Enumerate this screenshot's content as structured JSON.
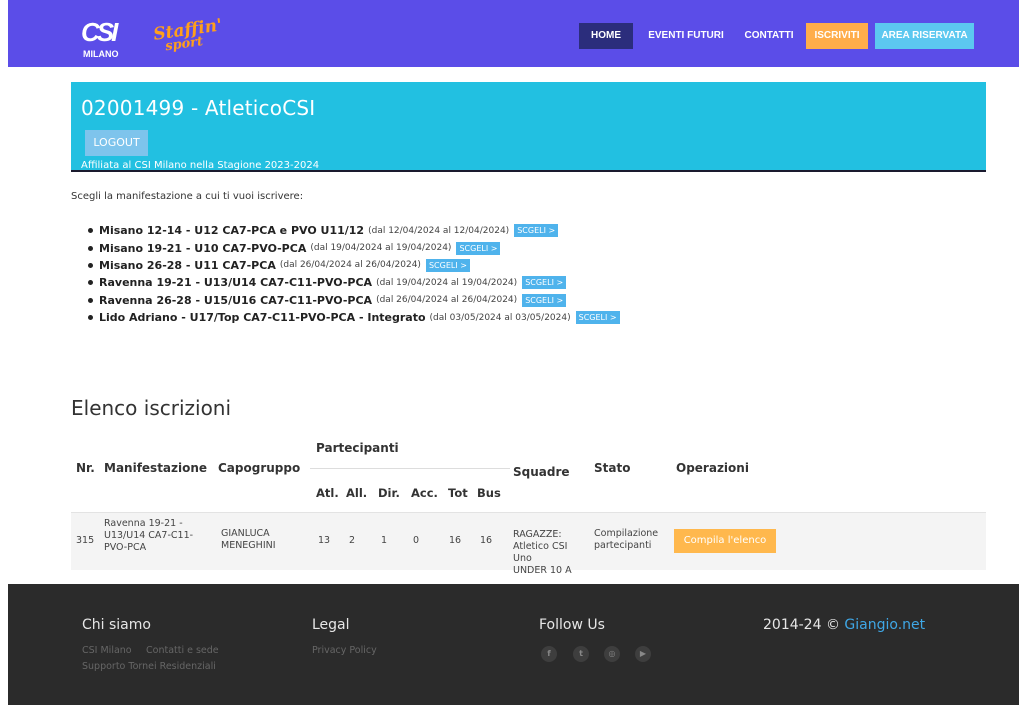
{
  "nav": {
    "logo_city": "MILANO",
    "logo_brand": "Staffin'",
    "logo_brand_sub": "sport",
    "items": [
      {
        "label": "HOME"
      },
      {
        "label": "EVENTI FUTURI"
      },
      {
        "label": "CONTATTI"
      },
      {
        "label": "ISCRIVITI"
      },
      {
        "label": "AREA RISERVATA"
      }
    ]
  },
  "header": {
    "title": "02001499 - AtleticoCSI",
    "logout_label": "LOGOUT",
    "affiliation": "Affiliata al CSI Milano nella Stagione 2023-2024"
  },
  "intro": "Scegli la manifestazione a cui ti vuoi iscrivere:",
  "events": [
    {
      "name": "Misano 12-14 - U12 CA7-PCA e PVO U11/12",
      "range": "(dal 12/04/2024 al 12/04/2024)",
      "button": "SCGELI >"
    },
    {
      "name": "Misano 19-21 - U10 CA7-PVO-PCA",
      "range": "(dal 19/04/2024 al 19/04/2024)",
      "button": "SCGELI >"
    },
    {
      "name": "Misano 26-28 - U11 CA7-PCA",
      "range": "(dal 26/04/2024 al 26/04/2024)",
      "button": "SCGELI >"
    },
    {
      "name": "Ravenna 19-21 - U13/U14 CA7-C11-PVO-PCA",
      "range": "(dal 19/04/2024 al 19/04/2024)",
      "button": "SCGELI >"
    },
    {
      "name": "Ravenna 26-28 - U15/U16 CA7-C11-PVO-PCA",
      "range": "(dal 26/04/2024 al 26/04/2024)",
      "button": "SCGELI >"
    },
    {
      "name": "Lido Adriano - U17/Top CA7-C11-PVO-PCA - Integrato",
      "range": "(dal 03/05/2024 al 03/05/2024)",
      "button": "SCGELI >"
    }
  ],
  "registrations": {
    "title": "Elenco iscrizioni",
    "headers": {
      "nr": "Nr.",
      "manifestazione": "Manifestazione",
      "capogruppo": "Capogruppo",
      "partecipanti": "Partecipanti",
      "atl": "Atl.",
      "all": "All.",
      "dir": "Dir.",
      "acc": "Acc.",
      "tot": "Tot",
      "bus": "Bus",
      "squadre": "Squadre",
      "stato": "Stato",
      "operazioni": "Operazioni"
    },
    "rows": [
      {
        "nr": "315",
        "manifestazione": [
          "Ravenna 19-21 -",
          "U13/U14 CA7-C11-",
          "PVO-PCA"
        ],
        "capogruppo": [
          "GIANLUCA",
          "MENEGHINI"
        ],
        "atl": "13",
        "all": "2",
        "dir": "1",
        "acc": "0",
        "tot": "16",
        "bus": "16",
        "squadre": [
          "RAGAZZE:",
          "Atletico CSI",
          "Uno",
          "UNDER 10 A"
        ],
        "stato": [
          "Compilazione",
          "partecipanti"
        ],
        "operazione": "Compila l'elenco"
      }
    ]
  },
  "footer": {
    "chi_siamo": {
      "title": "Chi siamo",
      "links": [
        "CSI Milano",
        "Contatti e sede",
        "Supporto Tornei Residenziali"
      ]
    },
    "legal": {
      "title": "Legal",
      "links": [
        "Privacy Policy"
      ]
    },
    "follow": {
      "title": "Follow Us",
      "icons": [
        "facebook-icon",
        "twitter-icon",
        "instagram-icon",
        "youtube-icon"
      ]
    },
    "copyright_prefix": "2014-24 ©",
    "copyright_link": "Giangio.net"
  },
  "colors": {
    "navbar": "#5b4de8",
    "home_active": "#2b2d7c",
    "iscriviti": "#ffad4a",
    "area_riservata": "#5cc8f0",
    "header_band": "#22c0e1",
    "scegli_button": "#4fb3ec",
    "compila_button": "#ffb84d",
    "footer": "#2b2b2b",
    "footer_link": "#3fa7e6"
  }
}
